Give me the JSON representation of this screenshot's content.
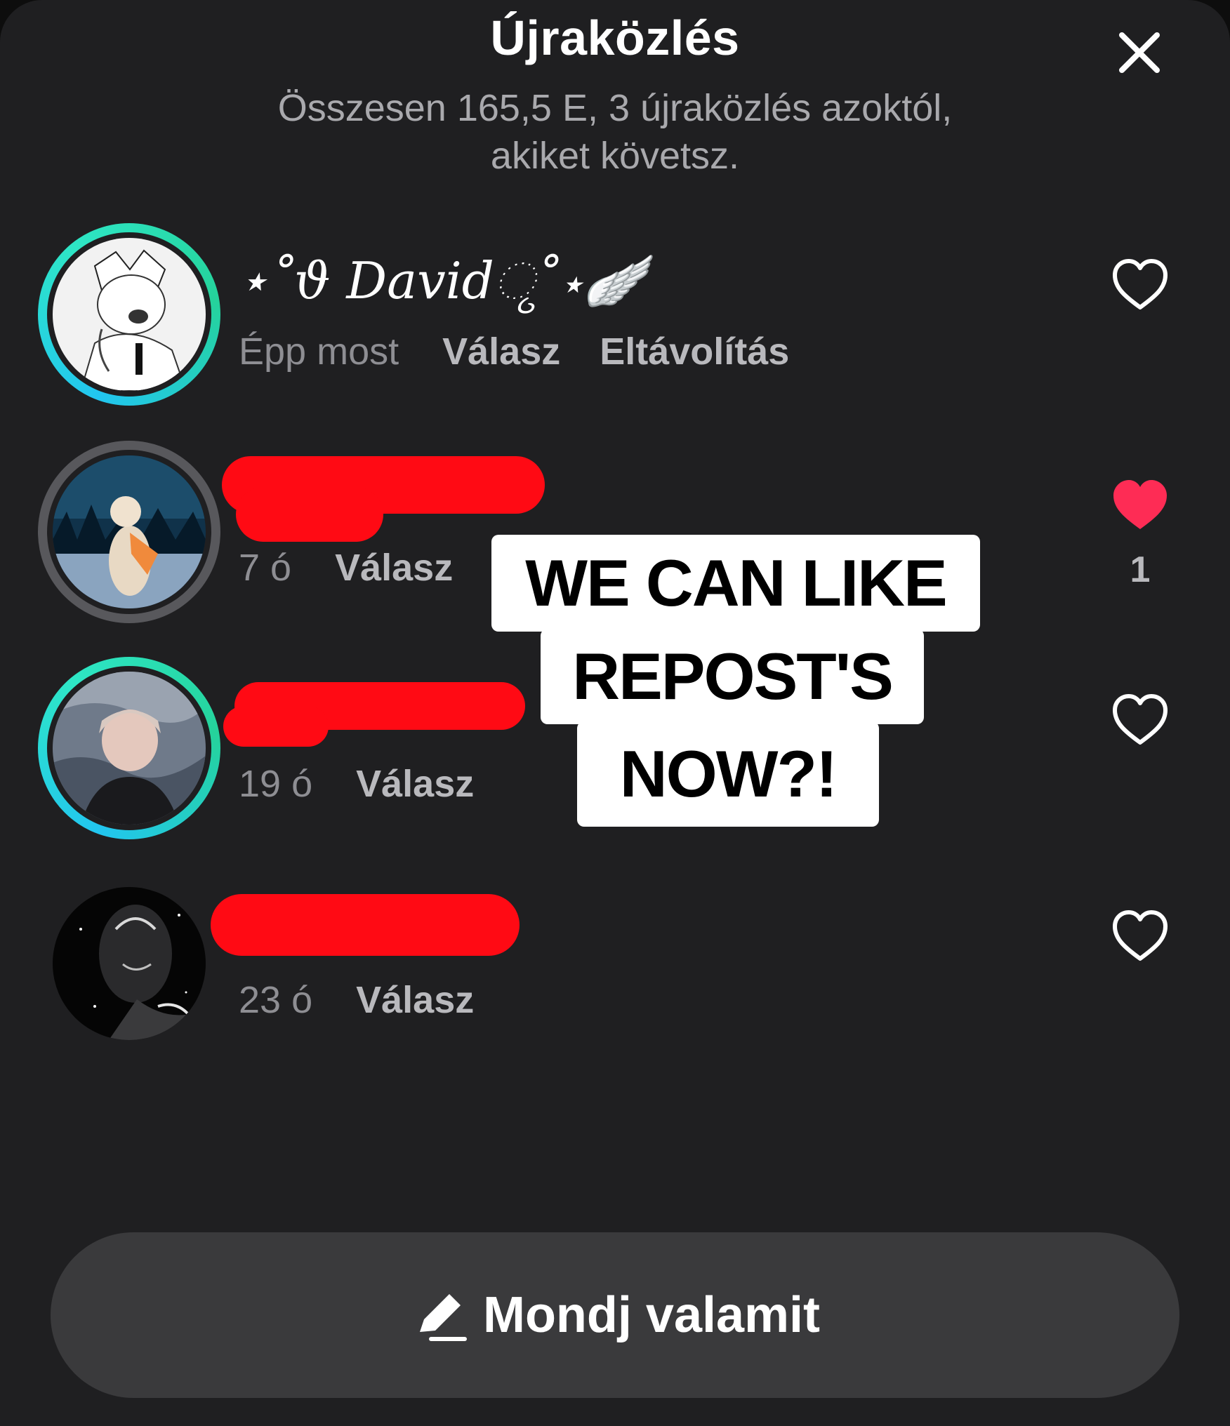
{
  "header": {
    "title": "Újraközlés",
    "subtitle": "Összesen 165,5 E, 3 újraközlés azoktól, akiket követsz."
  },
  "reposts": [
    {
      "username": "⋆˚ϑ Davidୃ˚⋆🪽",
      "time": "Épp most",
      "reply_label": "Válasz",
      "remove_label": "Eltávolítás",
      "liked": false,
      "username_redacted": false
    },
    {
      "time": "7 ó",
      "reply_label": "Válasz",
      "liked": true,
      "like_count": "1",
      "username_redacted": true
    },
    {
      "time": "19 ó",
      "reply_label": "Válasz",
      "liked": false,
      "username_redacted": true
    },
    {
      "time": "23 ó",
      "reply_label": "Válasz",
      "liked": false,
      "username_redacted": true
    }
  ],
  "overlay_text": {
    "line1": "WE CAN LIKE",
    "line2": "REPOST'S",
    "line3": "NOW?!"
  },
  "composer": {
    "placeholder": "Mondj valamit"
  },
  "colors": {
    "background": "#1f1f21",
    "like_red": "#fe2c55",
    "redaction": "#ff0a14",
    "ring_gradient": [
      "#22c6f0",
      "#25d39b"
    ]
  }
}
